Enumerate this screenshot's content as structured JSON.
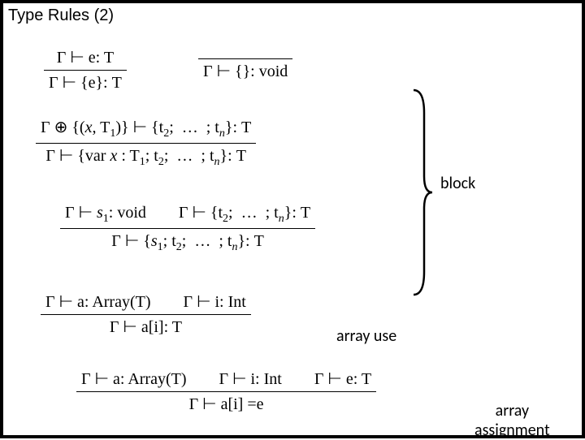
{
  "title": "Type Rules (2)",
  "labels": {
    "block": "block",
    "array_use": "array use",
    "array_assignment_l1": "array",
    "array_assignment_l2": "assignment"
  },
  "rules": {
    "block_single": {
      "premise": "Γ ⊢ e: T",
      "conclusion": "Γ ⊢ {e}: T"
    },
    "block_empty": {
      "premise": "",
      "conclusion": "Γ ⊢ {}: void"
    },
    "block_var": {
      "premise_html": "Γ ⊕ {(<i>x</i>, T<span class='sub'>1</span>)} ⊢ {t<span class='sub'>2</span>; &nbsp;…&nbsp; ; t<span class='sub'><i>n</i></span>}: T",
      "conclusion_html": "Γ ⊢ {var <i>x</i> : T<span class='sub'>1</span>; t<span class='sub'>2</span>; &nbsp;…&nbsp; ; t<span class='sub'><i>n</i></span>}: T"
    },
    "block_seq": {
      "premise1_html": "Γ ⊢ <i>s</i><span class='sub'>1</span>: void",
      "premise2_html": "Γ ⊢ {t<span class='sub'>2</span>; &nbsp;…&nbsp; ; t<span class='sub'><i>n</i></span>}: T",
      "conclusion_html": "Γ ⊢ {<i>s</i><span class='sub'>1</span>; t<span class='sub'>2</span>; &nbsp;…&nbsp; ; t<span class='sub'><i>n</i></span>}: T"
    },
    "array_use": {
      "premise1": "Γ ⊢ a: Array(T)",
      "premise2": "Γ ⊢ i: Int",
      "conclusion": "Γ ⊢ a[i]: T"
    },
    "array_assign": {
      "premise1": "Γ ⊢ a: Array(T)",
      "premise2": "Γ ⊢ i: Int",
      "premise3": "Γ ⊢ e: T",
      "conclusion": "Γ ⊢ a[i] =e"
    }
  }
}
